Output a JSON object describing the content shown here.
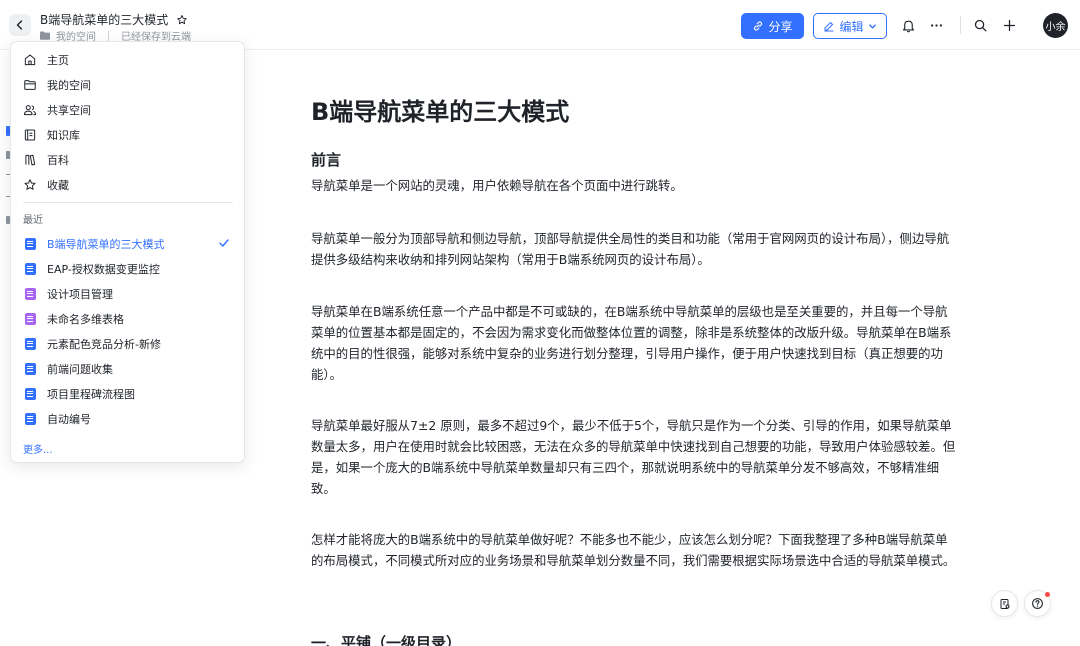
{
  "header": {
    "doc_title": "B端导航菜单的三大模式",
    "location": "我的空间",
    "save_status": "已经保存到云端",
    "share_label": "分享",
    "edit_label": "编辑",
    "avatar_text": "小余"
  },
  "dropdown": {
    "nav": [
      {
        "label": "主页",
        "icon": "home-icon"
      },
      {
        "label": "我的空间",
        "icon": "folder-icon"
      },
      {
        "label": "共享空间",
        "icon": "users-icon"
      },
      {
        "label": "知识库",
        "icon": "book-icon"
      },
      {
        "label": "百科",
        "icon": "wiki-icon"
      },
      {
        "label": "收藏",
        "icon": "star-icon"
      }
    ],
    "recent_label": "最近",
    "recent": [
      {
        "label": "B端导航菜单的三大模式",
        "type": "doc",
        "color": "#3370ff",
        "active": true
      },
      {
        "label": "EAP-授权数据变更监控",
        "type": "doc",
        "color": "#3370ff"
      },
      {
        "label": "设计项目管理",
        "type": "bitable",
        "color": "#a865f2"
      },
      {
        "label": "未命名多维表格",
        "type": "bitable",
        "color": "#a865f2"
      },
      {
        "label": "元素配色竞品分析-新修",
        "type": "doc",
        "color": "#3370ff"
      },
      {
        "label": "前端问题收集",
        "type": "doc",
        "color": "#3370ff"
      },
      {
        "label": "项目里程碑流程图",
        "type": "doc",
        "color": "#3370ff"
      },
      {
        "label": "自动编号",
        "type": "doc",
        "color": "#3370ff"
      }
    ],
    "more_label": "更多..."
  },
  "article": {
    "title": "B端导航菜单的三大模式",
    "section1": "前言",
    "paragraphs": [
      "导航菜单是一个网站的灵魂，用户依赖导航在各个页面中进行跳转。",
      "导航菜单一般分为顶部导航和侧边导航，顶部导航提供全局性的类目和功能（常用于官网网页的设计布局），侧边导航提供多级结构来收纳和排列网站架构（常用于B端系统网页的设计布局）。",
      "导航菜单在B端系统任意一个产品中都是不可或缺的，在B端系统中导航菜单的层级也是至关重要的，并且每一个导航菜单的位置基本都是固定的，不会因为需求变化而做整体位置的调整，除非是系统整体的改版升级。导航菜单在B端系统中的目的性很强，能够对系统中复杂的业务进行划分整理，引导用户操作，便于用户快速找到目标（真正想要的功能）。",
      "导航菜单最好服从7±2 原则，最多不超过9个，最少不低于5个，导航只是作为一个分类、引导的作用，如果导航菜单数量太多，用户在使用时就会比较困惑，无法在众多的导航菜单中快速找到自己想要的功能，导致用户体验感较差。但是，如果一个庞大的B端系统中导航菜单数量却只有三四个，那就说明系统中的导航菜单分发不够高效，不够精准细致。",
      "怎样才能将庞大的B端系统中的导航菜单做好呢？不能多也不能少，应该怎么划分呢？下面我整理了多种B端导航菜单的布局模式，不同模式所对应的业务场景和导航菜单划分数量不同，我们需要根据实际场景选中合适的导航菜单模式。"
    ],
    "section2": "一、平铺（一级目录）"
  }
}
